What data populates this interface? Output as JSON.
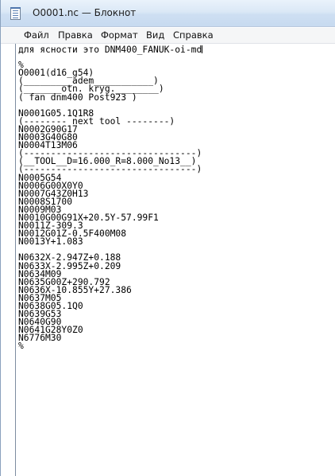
{
  "window": {
    "title": "O0001.nc — Блокнот"
  },
  "menu": {
    "items": [
      "Файл",
      "Правка",
      "Формат",
      "Вид",
      "Справка"
    ]
  },
  "editor": {
    "lines": [
      "для ясности это DNM400_FANUK-oi-md",
      "",
      "%",
      "O0001(d16_g54)",
      "(_________adem___________)",
      "(_______otn. kryg.________)",
      "( fan dnm400 Post923 )",
      "",
      "N0001G05.1Q1R8",
      "(-------- next tool --------)",
      "N0002G90G17",
      "N0003G40G80",
      "N0004T13M06",
      "(--------------------------------)",
      "(__TOOL__D=16.000_R=8.000_No13__)",
      "(--------------------------------)",
      "N0005G54",
      "N0006G00X0Y0",
      "N0007G43Z0H13",
      "N0008S1700",
      "N0009M03",
      "N0010G00G91X+20.5Y-57.99F1",
      "N0011Z-309.3",
      "N0012G01Z-0.5F400M08",
      "N0013Y+1.083",
      "",
      "N0632X-2.947Z+0.188",
      "N0633X-2.995Z+0.209",
      "N0634M09",
      "N0635G00Z+290.792",
      "N0636X-10.855Y+27.386",
      "N0637M05",
      "N0638G05.1Q0",
      "N0639G53",
      "N0640G90",
      "N0641G28Y0Z0",
      "N6776M30",
      "%"
    ]
  }
}
